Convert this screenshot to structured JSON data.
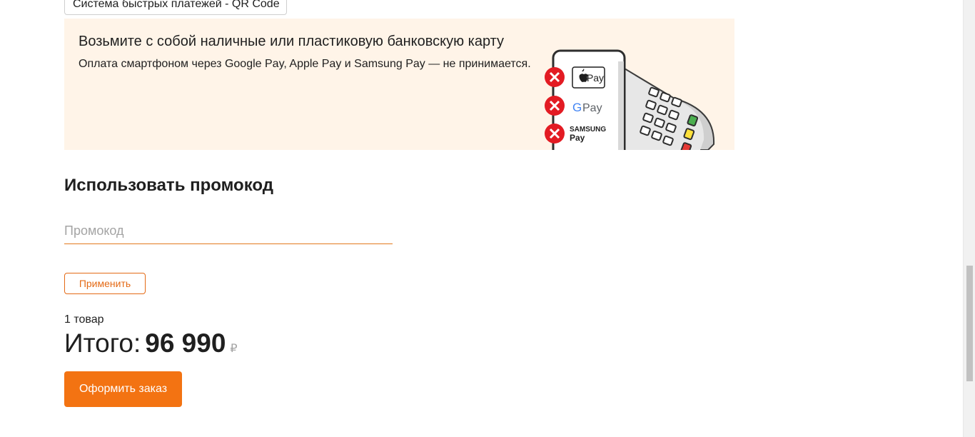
{
  "payment_method": {
    "selected_option_label": "Система быстрых платежей - QR Code"
  },
  "cash_notice": {
    "title": "Возьмите с собой наличные или пластиковую банковскую карту",
    "description": "Оплата смартфоном через Google Pay, Apple Pay и Samsung Pay — не принимается.",
    "disabled_wallets": [
      {
        "label": "Pay",
        "icon": "apple-icon"
      },
      {
        "label": "Pay",
        "icon": "google-icon"
      },
      {
        "label_line_1": "SAMSUNG",
        "label_line_2": "Pay",
        "icon": "samsung-icon"
      }
    ],
    "background_color": "#fff4e8",
    "cross_color": "#e31b23"
  },
  "promo": {
    "title": "Использовать промокод",
    "placeholder": "Промокод",
    "value": "",
    "apply_label": "Применить"
  },
  "summary": {
    "item_count": "1 товар",
    "total_label": "Итого:",
    "total_value": "96 990",
    "currency_symbol": "₽",
    "checkout_label": "Оформить заказ"
  },
  "colors": {
    "accent": "#f37312",
    "accent_border": "#e46a15",
    "text": "#1f1f1f",
    "muted": "#a4a4a4"
  }
}
